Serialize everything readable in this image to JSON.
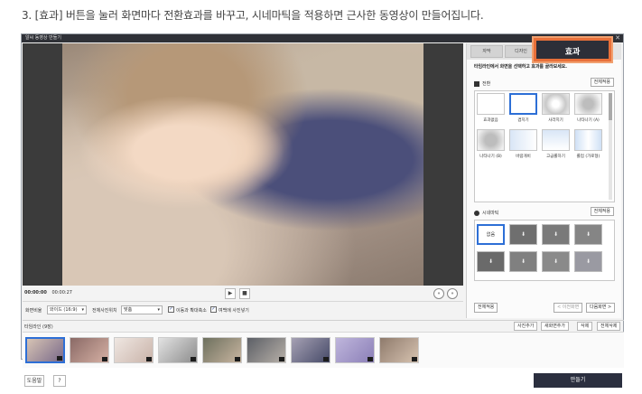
{
  "caption": "3. [효과] 버튼을 눌러 화면마다 전환효과를 바꾸고, 시네마틱을 적용하면 근사한 동영상이 만들어집니다.",
  "window": {
    "title": "알씨 동영상 만들기",
    "close_glyph": "✕"
  },
  "player": {
    "time_current": "00:00:00",
    "time_total": "00:00:27",
    "play_glyph": "▶",
    "stop_glyph": "■",
    "prev_glyph": "«",
    "next_glyph": "»"
  },
  "options": {
    "ratio_label": "화면비율",
    "ratio_value": "와이드 (16:9)",
    "photo_pos_label": "전체사진위치",
    "photo_pos_value": "맞춤",
    "move_zoom_label": "이동과 확대축소",
    "fill_blank_label": "여백에 사진넣기",
    "move_zoom_checked": "✓",
    "fill_blank_checked": "✓"
  },
  "timeline": {
    "title": "타임라인 (9장)",
    "add_photo": "사진추가",
    "add_screen": "새화면추가",
    "delete": "삭제",
    "delete_all": "전체삭제",
    "thumbs": [
      {
        "c1": "#d7c4b4",
        "c2": "#7a6a8a"
      },
      {
        "c1": "#8a6a66",
        "c2": "#d6b0a4"
      },
      {
        "c1": "#efe7e2",
        "c2": "#c9b3a9"
      },
      {
        "c1": "#e2e2e2",
        "c2": "#8c8c8c"
      },
      {
        "c1": "#6d705e",
        "c2": "#c8b5a0"
      },
      {
        "c1": "#5c5f66",
        "c2": "#b7b0a8"
      },
      {
        "c1": "#a6a1b4",
        "c2": "#464a68"
      },
      {
        "c1": "#bfb6dc",
        "c2": "#8b7fb7"
      },
      {
        "c1": "#8f7b6c",
        "c2": "#d6c2b0"
      }
    ]
  },
  "bottom": {
    "help": "도움말",
    "question": "?",
    "make": "만들기"
  },
  "panel": {
    "tab_1": "자막",
    "tab_2": "디자인",
    "tab_active": "효과",
    "instruction": "타임라인에서 화면을 선택하고 효과를 골라보세요.",
    "transition_head": "전환",
    "apply_all": "전체적용",
    "transitions": [
      {
        "label": "효과없음"
      },
      {
        "label": "겹치기"
      },
      {
        "label": "사라지기"
      },
      {
        "label": "나타나기 (A)"
      },
      {
        "label": "나타나기 (B)"
      },
      {
        "label": "바람개비"
      },
      {
        "label": "고급롤하기"
      },
      {
        "label": "롤업 (가로형)"
      }
    ],
    "cinematic_head": "시네마틱",
    "cine_none": "없음",
    "cine_glyph": "⬇",
    "panel_apply_all": "전체적용",
    "prev_screen": "< 이전화면",
    "next_screen": "다음화면 >",
    "accent": "#e8703a",
    "select_blue": "#2d6fd6"
  }
}
